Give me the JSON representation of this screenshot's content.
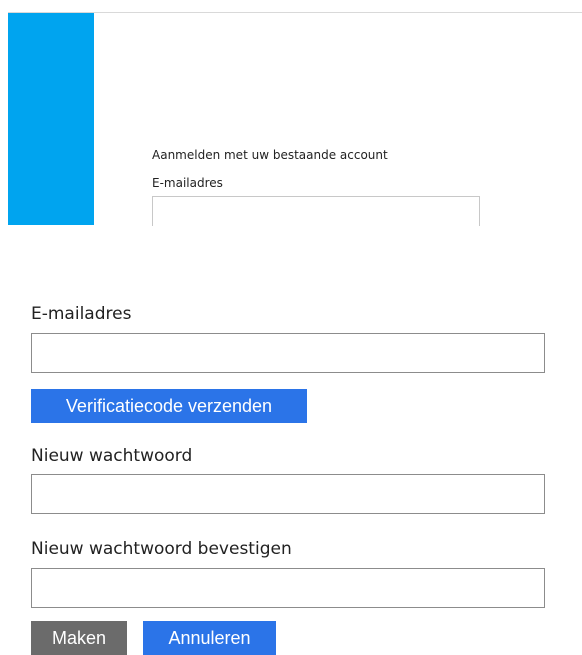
{
  "login": {
    "heading": "Aanmelden met uw bestaande account",
    "email_label": "E-mailadres",
    "email_value": ""
  },
  "reset_form": {
    "email_label": "E-mailadres",
    "email_value": "",
    "send_code_button": "Verificatiecode verzenden",
    "new_password_label": "Nieuw wachtwoord",
    "new_password_value": "",
    "confirm_password_label": "Nieuw wachtwoord bevestigen",
    "confirm_password_value": "",
    "create_button": "Maken",
    "cancel_button": "Annuleren"
  },
  "colors": {
    "brand_bar": "#00a4ef",
    "primary_button": "#2b74e8",
    "secondary_button": "#6b6b6b"
  }
}
